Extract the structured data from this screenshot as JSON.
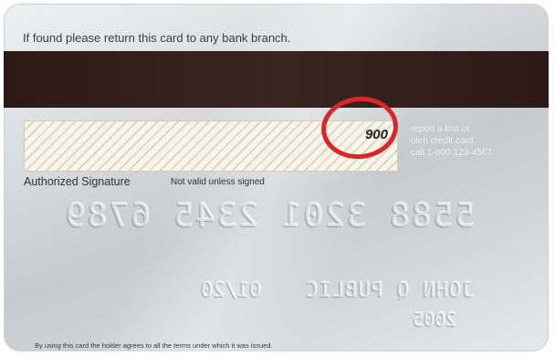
{
  "card": {
    "return_notice": "If found please return this card to any bank branch.",
    "cvv": "900",
    "lost_notice": [
      "report a lost or",
      "olen credit card,",
      "call 1-800-123-4567."
    ],
    "authorized_signature": "Authorized Signature",
    "not_valid": "Not valid unless signed",
    "embossed_number": "5588 3201 2345 6789",
    "embossed_expiry": "01/20",
    "embossed_name": "JOHN Q PUBLIC",
    "embossed_since": "2005",
    "terms": "By using this card the holder agrees to all the terms under which it was issued."
  },
  "colors": {
    "highlight_circle": "#d9262a",
    "mag_stripe": "#2b1a16"
  }
}
